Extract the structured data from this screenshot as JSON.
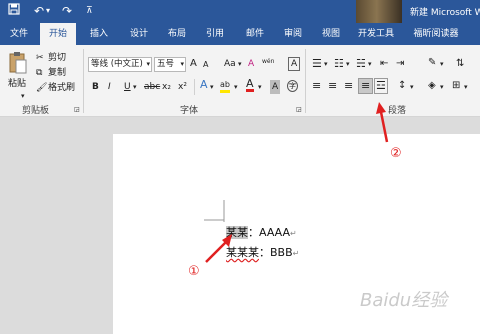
{
  "quick_access": {
    "save_icon": "save-icon",
    "undo_icon": "undo-icon",
    "redo_icon": "redo-icon",
    "customize": "⊼"
  },
  "window": {
    "title": "新建 Microsoft W"
  },
  "tabs": [
    {
      "label": "文件"
    },
    {
      "label": "开始",
      "active": true
    },
    {
      "label": "插入"
    },
    {
      "label": "设计"
    },
    {
      "label": "布局"
    },
    {
      "label": "引用"
    },
    {
      "label": "邮件"
    },
    {
      "label": "审阅"
    },
    {
      "label": "视图"
    },
    {
      "label": "开发工具"
    },
    {
      "label": "福昕阅读器"
    }
  ],
  "clipboard": {
    "paste": "粘贴",
    "cut": "剪切",
    "copy": "复制",
    "format_painter": "格式刷",
    "group_label": "剪贴板"
  },
  "font": {
    "name": "等线 (中文正)",
    "size": "五号",
    "bold": "B",
    "italic": "I",
    "underline": "U",
    "strike": "abc",
    "subscript": "x₂",
    "superscript": "x²",
    "group_label": "字体",
    "grow": "A",
    "shrink": "A",
    "case": "Aa",
    "clear": "A",
    "phonetic": "wén",
    "border": "A",
    "text_effect": "A",
    "highlight": "ab",
    "color": "A",
    "shading": "A",
    "enclose": "字"
  },
  "paragraph": {
    "group_label": "段落"
  },
  "document": {
    "line1": {
      "selected": "某某",
      "rest": "：AAAA",
      "mark": "↵"
    },
    "line2": {
      "text": "某某某",
      "rest": "：BBB",
      "mark": "↵"
    }
  },
  "annotations": {
    "one": "①",
    "two": "②"
  },
  "colors": {
    "accent": "#2b579a",
    "arrow": "#e02020"
  },
  "watermark": "Baidu经验"
}
